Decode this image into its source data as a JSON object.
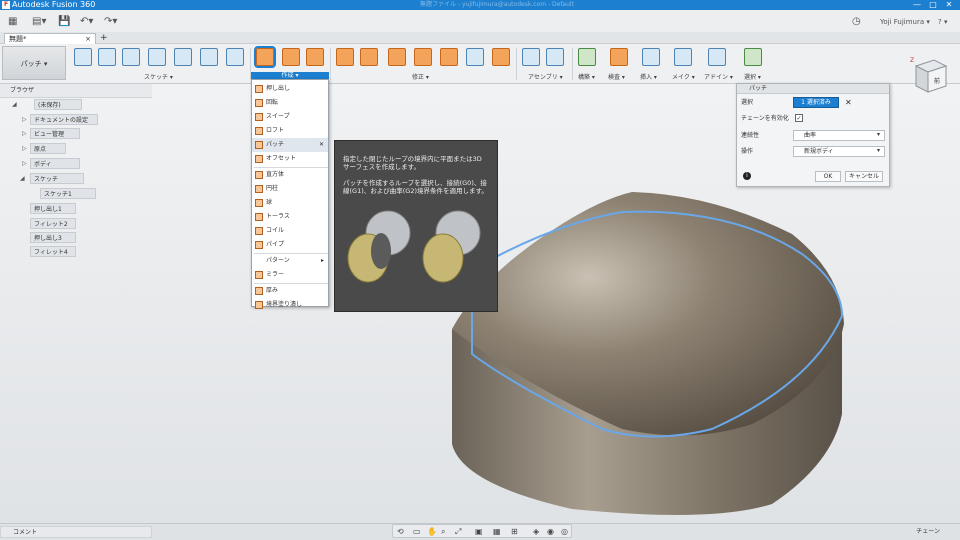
{
  "window": {
    "title": "Autodesk Fusion 360",
    "blur_text": "無題ファイル - yujifujimura@autodesk.com - Default"
  },
  "qat": {
    "user": "Yoji Fujimura ▾",
    "help": "? ▾",
    "clock": "◷"
  },
  "tab": {
    "label": "無題*",
    "close": "×",
    "new": "+"
  },
  "workspace": {
    "label": "パッチ ▾"
  },
  "ribbon_groups": [
    {
      "label": "スケッチ ▾"
    },
    {
      "label": "作成 ▾"
    },
    {
      "label": "修正 ▾"
    },
    {
      "label": "アセンブリ ▾"
    },
    {
      "label": "構築 ▾"
    },
    {
      "label": "検査 ▾"
    },
    {
      "label": "挿入 ▾"
    },
    {
      "label": "メイク ▾"
    },
    {
      "label": "アドイン ▾"
    },
    {
      "label": "選択 ▾"
    }
  ],
  "browser": {
    "title": "ブラウザ",
    "items": [
      {
        "label": "(未保存)"
      },
      {
        "label": "ドキュメントの設定"
      },
      {
        "label": "ビュー管理"
      },
      {
        "label": "原点"
      },
      {
        "label": "ボディ"
      },
      {
        "label": "スケッチ"
      },
      {
        "label": "スケッチ1"
      },
      {
        "label": "押し出し1"
      },
      {
        "label": "フィレット2"
      },
      {
        "label": "押し出し3"
      },
      {
        "label": "フィレット4"
      }
    ]
  },
  "create_menu": {
    "header": "作成 ▾",
    "items": [
      {
        "label": "押し出し"
      },
      {
        "label": "回転"
      },
      {
        "label": "スイープ"
      },
      {
        "label": "ロフト"
      },
      {
        "label": "パッチ"
      },
      {
        "label": "オフセット"
      },
      {
        "label": "直方体"
      },
      {
        "label": "円柱"
      },
      {
        "label": "球"
      },
      {
        "label": "トーラス"
      },
      {
        "label": "コイル"
      },
      {
        "label": "パイプ"
      },
      {
        "label": "パターン"
      },
      {
        "label": "ミラー"
      },
      {
        "label": "厚み"
      },
      {
        "label": "境界塗り潰し"
      }
    ]
  },
  "tooltip": {
    "p1": "指定した閉じたループの境界内に平面または3D サーフェスを作成します。",
    "p2": "パッチを作成するループを選択し、接続(G0)、接線(G1)、および曲率(G2)境界条件を適用します。"
  },
  "patch_panel": {
    "title": "パッチ",
    "selection_label": "選択",
    "selection_value": "1 選択済み",
    "chain_label": "チェーンを有効化",
    "continuity_label": "連続性",
    "continuity_value": "曲率",
    "operation_label": "操作",
    "operation_value": "新規ボディ",
    "ok": "OK",
    "cancel": "キャンセル",
    "info": "i"
  },
  "viewcube": {
    "label": "前"
  },
  "statusbar": {
    "comment": "コメント",
    "chain": "チェーン"
  }
}
